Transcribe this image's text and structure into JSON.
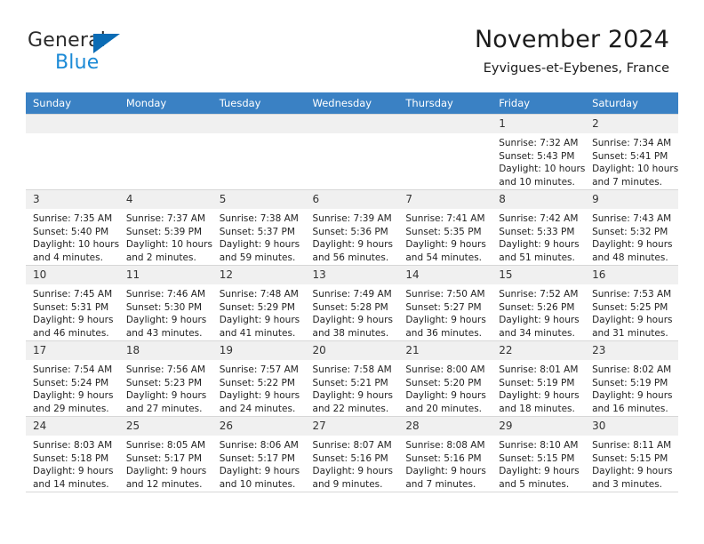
{
  "brand": {
    "name_part1": "General",
    "name_part2": "Blue",
    "logo_icon": "triangle-logo-icon"
  },
  "header": {
    "title": "November 2024",
    "location": "Eyvigues-et-Eybenes, France"
  },
  "colors": {
    "header_row_bg": "#3a81c4",
    "daynum_bg": "#f0f0f0",
    "brand_blue": "#1b8ad6",
    "logo_blue": "#0b6cb5",
    "grid_line": "#d7d7d7",
    "text": "#232323"
  },
  "calendar": {
    "weekday_headers": [
      "Sunday",
      "Monday",
      "Tuesday",
      "Wednesday",
      "Thursday",
      "Friday",
      "Saturday"
    ],
    "weeks": [
      [
        {
          "day": "",
          "lines": []
        },
        {
          "day": "",
          "lines": []
        },
        {
          "day": "",
          "lines": []
        },
        {
          "day": "",
          "lines": []
        },
        {
          "day": "",
          "lines": []
        },
        {
          "day": "1",
          "lines": [
            "Sunrise: 7:32 AM",
            "Sunset: 5:43 PM",
            "Daylight: 10 hours",
            "and 10 minutes."
          ]
        },
        {
          "day": "2",
          "lines": [
            "Sunrise: 7:34 AM",
            "Sunset: 5:41 PM",
            "Daylight: 10 hours",
            "and 7 minutes."
          ]
        }
      ],
      [
        {
          "day": "3",
          "lines": [
            "Sunrise: 7:35 AM",
            "Sunset: 5:40 PM",
            "Daylight: 10 hours",
            "and 4 minutes."
          ]
        },
        {
          "day": "4",
          "lines": [
            "Sunrise: 7:37 AM",
            "Sunset: 5:39 PM",
            "Daylight: 10 hours",
            "and 2 minutes."
          ]
        },
        {
          "day": "5",
          "lines": [
            "Sunrise: 7:38 AM",
            "Sunset: 5:37 PM",
            "Daylight: 9 hours",
            "and 59 minutes."
          ]
        },
        {
          "day": "6",
          "lines": [
            "Sunrise: 7:39 AM",
            "Sunset: 5:36 PM",
            "Daylight: 9 hours",
            "and 56 minutes."
          ]
        },
        {
          "day": "7",
          "lines": [
            "Sunrise: 7:41 AM",
            "Sunset: 5:35 PM",
            "Daylight: 9 hours",
            "and 54 minutes."
          ]
        },
        {
          "day": "8",
          "lines": [
            "Sunrise: 7:42 AM",
            "Sunset: 5:33 PM",
            "Daylight: 9 hours",
            "and 51 minutes."
          ]
        },
        {
          "day": "9",
          "lines": [
            "Sunrise: 7:43 AM",
            "Sunset: 5:32 PM",
            "Daylight: 9 hours",
            "and 48 minutes."
          ]
        }
      ],
      [
        {
          "day": "10",
          "lines": [
            "Sunrise: 7:45 AM",
            "Sunset: 5:31 PM",
            "Daylight: 9 hours",
            "and 46 minutes."
          ]
        },
        {
          "day": "11",
          "lines": [
            "Sunrise: 7:46 AM",
            "Sunset: 5:30 PM",
            "Daylight: 9 hours",
            "and 43 minutes."
          ]
        },
        {
          "day": "12",
          "lines": [
            "Sunrise: 7:48 AM",
            "Sunset: 5:29 PM",
            "Daylight: 9 hours",
            "and 41 minutes."
          ]
        },
        {
          "day": "13",
          "lines": [
            "Sunrise: 7:49 AM",
            "Sunset: 5:28 PM",
            "Daylight: 9 hours",
            "and 38 minutes."
          ]
        },
        {
          "day": "14",
          "lines": [
            "Sunrise: 7:50 AM",
            "Sunset: 5:27 PM",
            "Daylight: 9 hours",
            "and 36 minutes."
          ]
        },
        {
          "day": "15",
          "lines": [
            "Sunrise: 7:52 AM",
            "Sunset: 5:26 PM",
            "Daylight: 9 hours",
            "and 34 minutes."
          ]
        },
        {
          "day": "16",
          "lines": [
            "Sunrise: 7:53 AM",
            "Sunset: 5:25 PM",
            "Daylight: 9 hours",
            "and 31 minutes."
          ]
        }
      ],
      [
        {
          "day": "17",
          "lines": [
            "Sunrise: 7:54 AM",
            "Sunset: 5:24 PM",
            "Daylight: 9 hours",
            "and 29 minutes."
          ]
        },
        {
          "day": "18",
          "lines": [
            "Sunrise: 7:56 AM",
            "Sunset: 5:23 PM",
            "Daylight: 9 hours",
            "and 27 minutes."
          ]
        },
        {
          "day": "19",
          "lines": [
            "Sunrise: 7:57 AM",
            "Sunset: 5:22 PM",
            "Daylight: 9 hours",
            "and 24 minutes."
          ]
        },
        {
          "day": "20",
          "lines": [
            "Sunrise: 7:58 AM",
            "Sunset: 5:21 PM",
            "Daylight: 9 hours",
            "and 22 minutes."
          ]
        },
        {
          "day": "21",
          "lines": [
            "Sunrise: 8:00 AM",
            "Sunset: 5:20 PM",
            "Daylight: 9 hours",
            "and 20 minutes."
          ]
        },
        {
          "day": "22",
          "lines": [
            "Sunrise: 8:01 AM",
            "Sunset: 5:19 PM",
            "Daylight: 9 hours",
            "and 18 minutes."
          ]
        },
        {
          "day": "23",
          "lines": [
            "Sunrise: 8:02 AM",
            "Sunset: 5:19 PM",
            "Daylight: 9 hours",
            "and 16 minutes."
          ]
        }
      ],
      [
        {
          "day": "24",
          "lines": [
            "Sunrise: 8:03 AM",
            "Sunset: 5:18 PM",
            "Daylight: 9 hours",
            "and 14 minutes."
          ]
        },
        {
          "day": "25",
          "lines": [
            "Sunrise: 8:05 AM",
            "Sunset: 5:17 PM",
            "Daylight: 9 hours",
            "and 12 minutes."
          ]
        },
        {
          "day": "26",
          "lines": [
            "Sunrise: 8:06 AM",
            "Sunset: 5:17 PM",
            "Daylight: 9 hours",
            "and 10 minutes."
          ]
        },
        {
          "day": "27",
          "lines": [
            "Sunrise: 8:07 AM",
            "Sunset: 5:16 PM",
            "Daylight: 9 hours",
            "and 9 minutes."
          ]
        },
        {
          "day": "28",
          "lines": [
            "Sunrise: 8:08 AM",
            "Sunset: 5:16 PM",
            "Daylight: 9 hours",
            "and 7 minutes."
          ]
        },
        {
          "day": "29",
          "lines": [
            "Sunrise: 8:10 AM",
            "Sunset: 5:15 PM",
            "Daylight: 9 hours",
            "and 5 minutes."
          ]
        },
        {
          "day": "30",
          "lines": [
            "Sunrise: 8:11 AM",
            "Sunset: 5:15 PM",
            "Daylight: 9 hours",
            "and 3 minutes."
          ]
        }
      ]
    ]
  }
}
